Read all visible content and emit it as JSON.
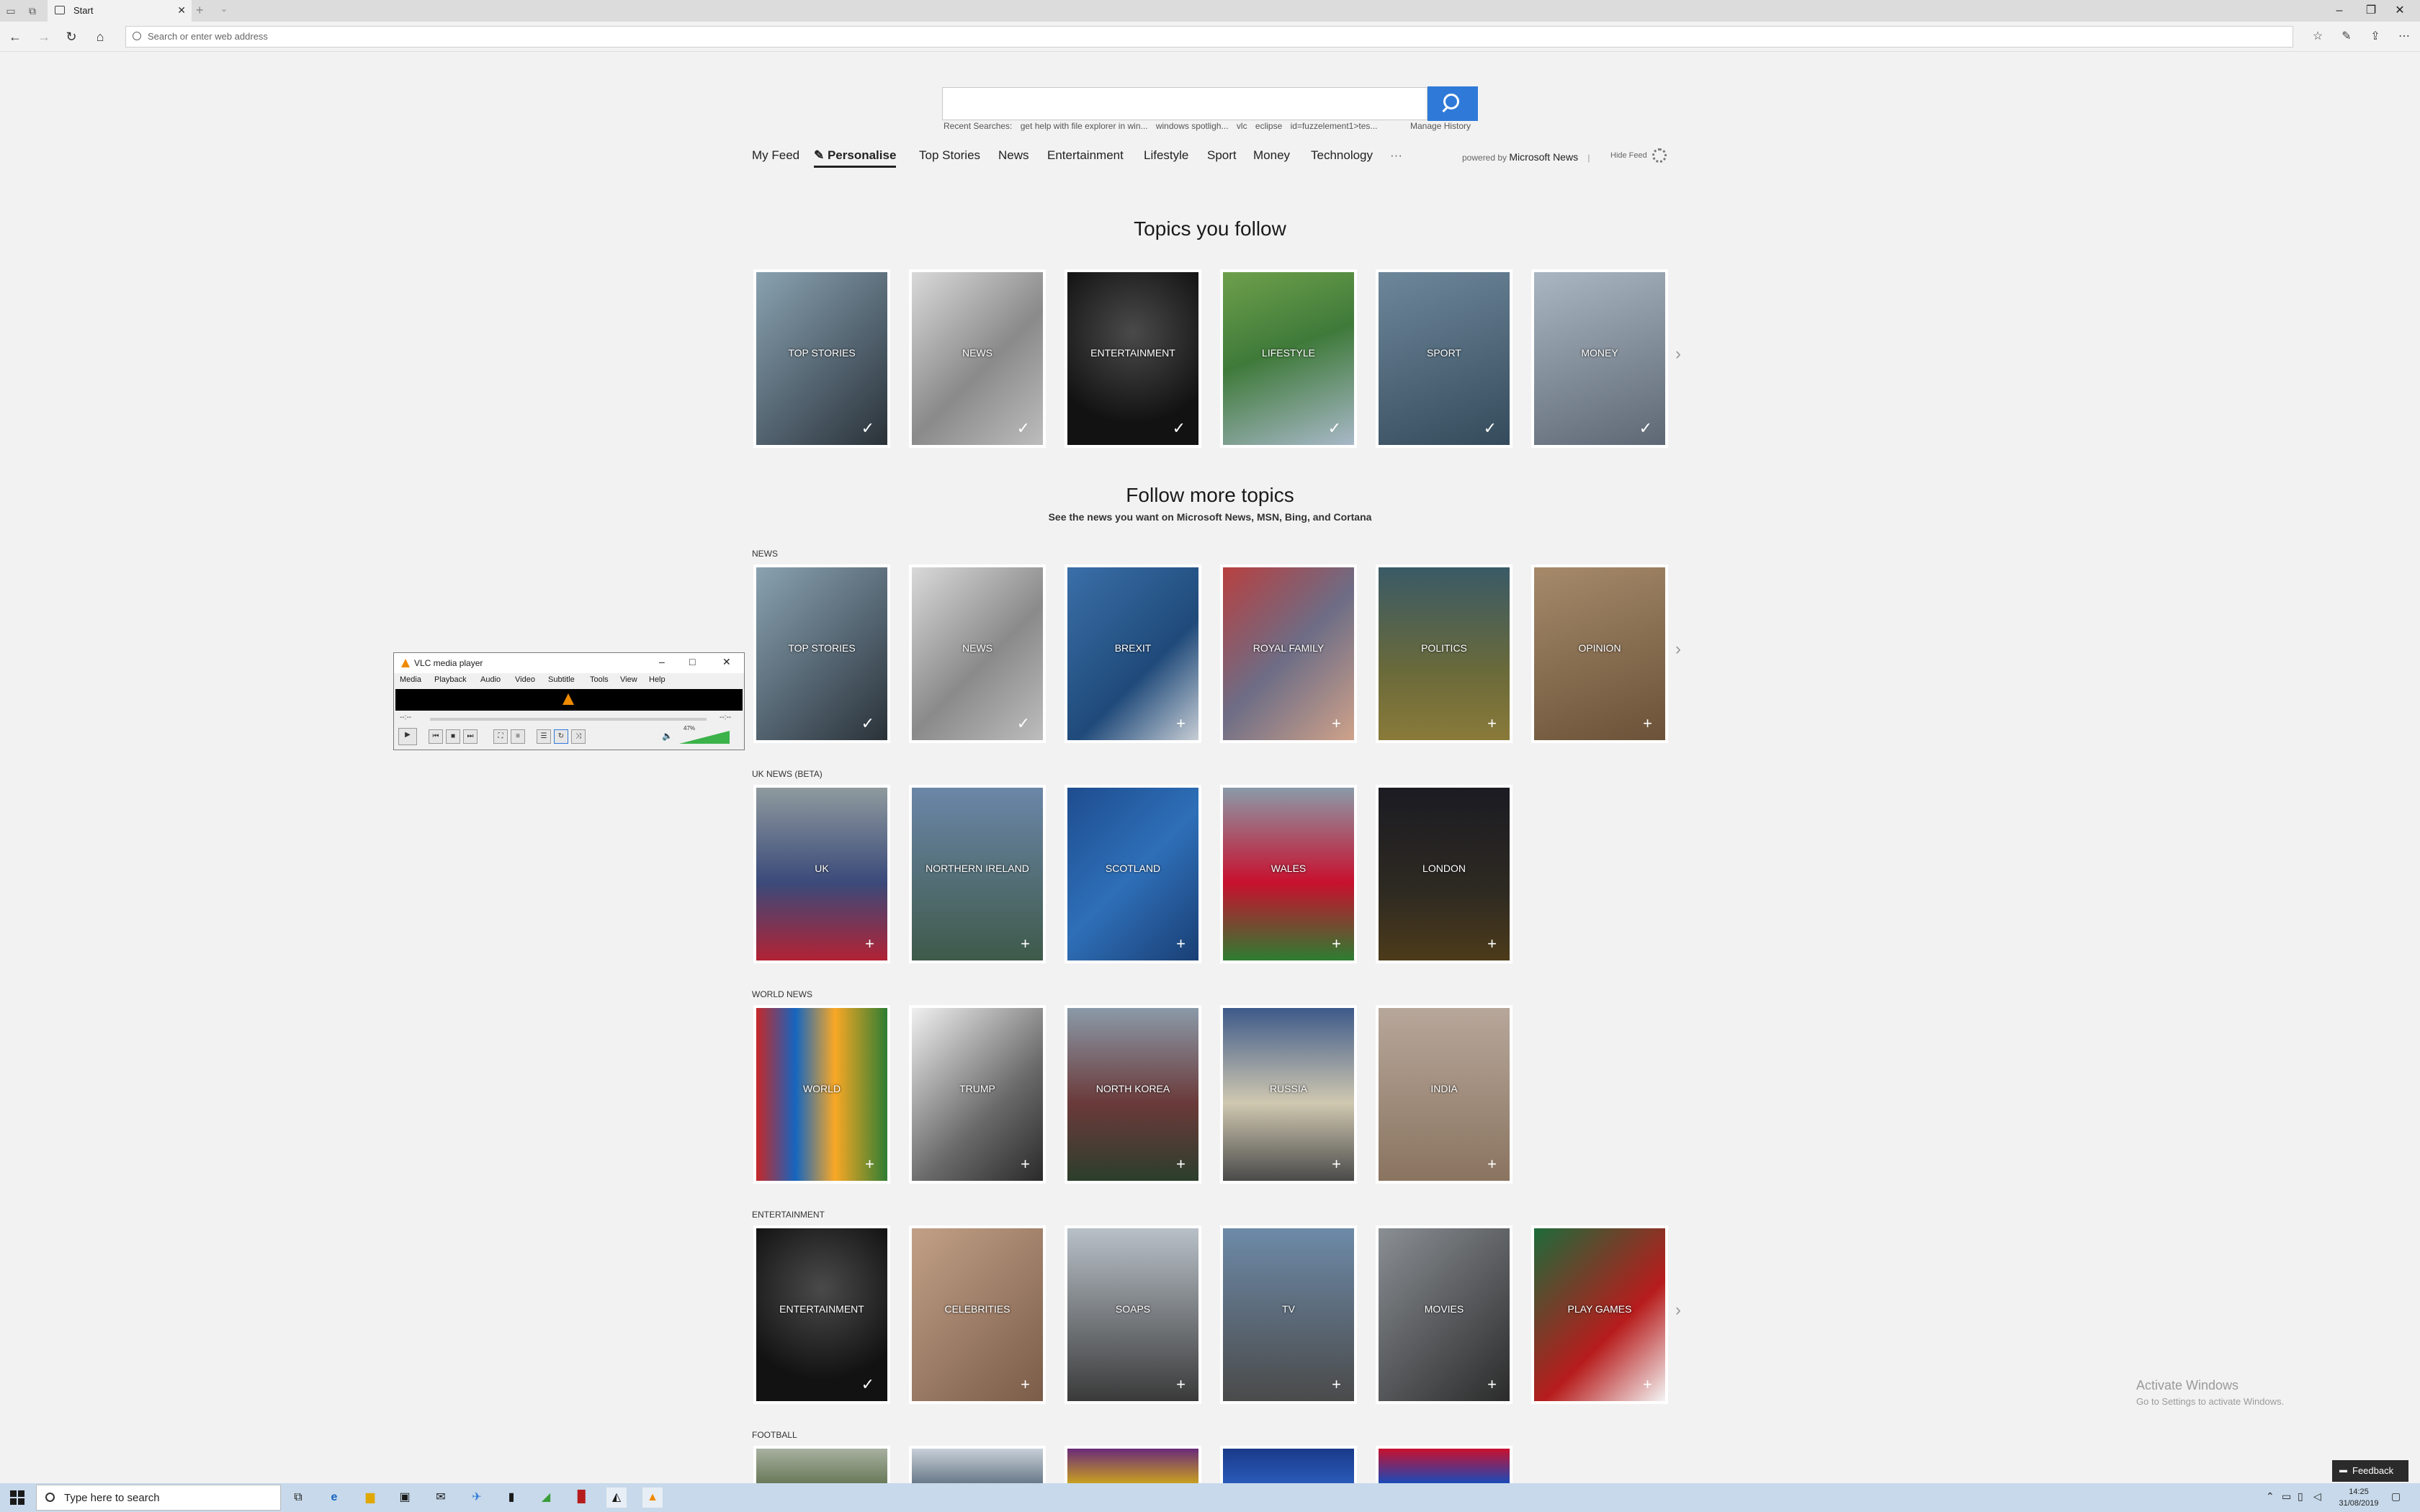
{
  "browser": {
    "tab_title": "Start",
    "new_tab": "+",
    "tab_menu": "⌄",
    "address_placeholder": "Search or enter web address",
    "window_minimize": "–",
    "window_restore": "❐",
    "window_close": "✕"
  },
  "search": {
    "recent_label": "Recent Searches:",
    "recent_items": [
      "get help with file explorer in win...",
      "windows spotligh...",
      "vlc",
      "eclipse",
      "id=fuzzelement1>tes..."
    ],
    "manage_history": "Manage History"
  },
  "feed_nav": {
    "items": [
      "My Feed",
      "Personalise",
      "Top Stories",
      "News",
      "Entertainment",
      "Lifestyle",
      "Sport",
      "Money",
      "Technology",
      "···"
    ],
    "active": "Personalise",
    "powered_by_prefix": "powered by",
    "powered_by_brand": "Microsoft News",
    "divider": "|",
    "hide_feed": "Hide Feed"
  },
  "topics_you_follow": {
    "heading": "Topics you follow",
    "tiles": [
      {
        "label": "TOP STORIES",
        "state": "✓"
      },
      {
        "label": "NEWS",
        "state": "✓"
      },
      {
        "label": "ENTERTAINMENT",
        "state": "✓"
      },
      {
        "label": "LIFESTYLE",
        "state": "✓"
      },
      {
        "label": "SPORT",
        "state": "✓"
      },
      {
        "label": "MONEY",
        "state": "✓"
      }
    ]
  },
  "follow_more": {
    "heading": "Follow more topics",
    "subheading": "See the news you want on Microsoft News, MSN, Bing, and Cortana",
    "sections": [
      {
        "label": "NEWS",
        "tiles": [
          {
            "label": "TOP STORIES",
            "state": "✓"
          },
          {
            "label": "NEWS",
            "state": "✓"
          },
          {
            "label": "BREXIT",
            "state": "+"
          },
          {
            "label": "ROYAL FAMILY",
            "state": "+"
          },
          {
            "label": "POLITICS",
            "state": "+"
          },
          {
            "label": "OPINION",
            "state": "+"
          }
        ]
      },
      {
        "label": "UK NEWS (BETA)",
        "tiles": [
          {
            "label": "UK",
            "state": "+"
          },
          {
            "label": "NORTHERN IRELAND",
            "state": "+"
          },
          {
            "label": "SCOTLAND",
            "state": "+"
          },
          {
            "label": "WALES",
            "state": "+"
          },
          {
            "label": "LONDON",
            "state": "+"
          }
        ]
      },
      {
        "label": "WORLD NEWS",
        "tiles": [
          {
            "label": "WORLD",
            "state": "+"
          },
          {
            "label": "TRUMP",
            "state": "+"
          },
          {
            "label": "NORTH KOREA",
            "state": "+"
          },
          {
            "label": "RUSSIA",
            "state": "+"
          },
          {
            "label": "INDIA",
            "state": "+"
          }
        ]
      },
      {
        "label": "ENTERTAINMENT",
        "tiles": [
          {
            "label": "ENTERTAINMENT",
            "state": "✓"
          },
          {
            "label": "CELEBRITIES",
            "state": "+"
          },
          {
            "label": "SOAPS",
            "state": "+"
          },
          {
            "label": "TV",
            "state": "+"
          },
          {
            "label": "MOVIES",
            "state": "+"
          },
          {
            "label": "PLAY GAMES",
            "state": "+"
          }
        ]
      },
      {
        "label": "FOOTBALL",
        "tiles": []
      }
    ],
    "row_arrow": "›"
  },
  "vlc": {
    "title": "VLC media player",
    "menu": [
      "Media",
      "Playback",
      "Audio",
      "Video",
      "Subtitle",
      "Tools",
      "View",
      "Help"
    ],
    "time_elapsed": "--:--",
    "time_total": "--:--",
    "volume": "47%",
    "win_min": "–",
    "win_max": "□",
    "win_close": "✕"
  },
  "watermark": {
    "title": "Activate Windows",
    "subtitle": "Go to Settings to activate Windows."
  },
  "feedback_label": "Feedback",
  "taskbar": {
    "search_placeholder": "Type here to search",
    "time": "14:25",
    "date": "31/08/2019"
  },
  "colors": {
    "accent": "#2f7ad8",
    "page_background": "#f2f2f2",
    "taskbar": "#c7d9ea",
    "vlc_orange": "#f08a00"
  }
}
